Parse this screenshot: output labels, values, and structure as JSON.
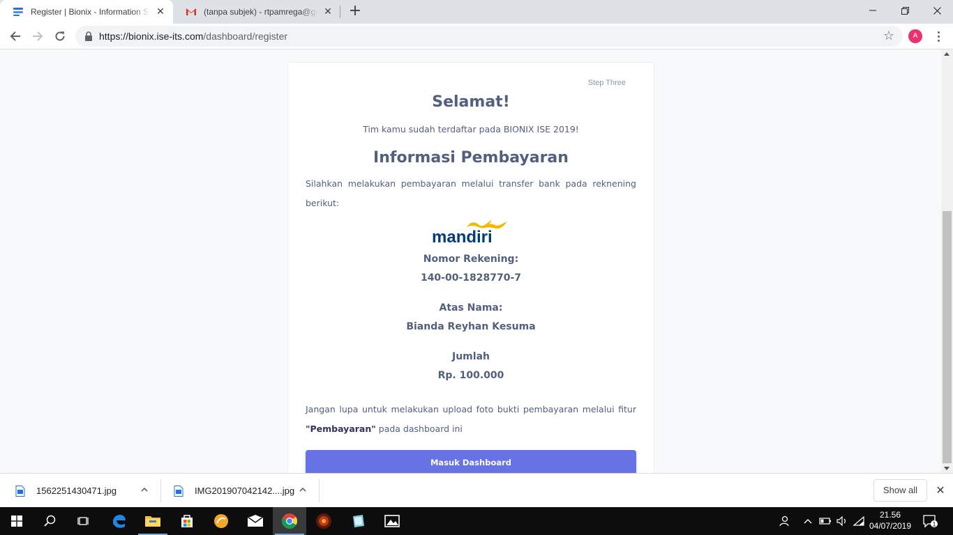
{
  "browser": {
    "tabs": [
      {
        "title": "Register | Bionix - Information Sy",
        "favicon": "bionix-favicon",
        "active": true
      },
      {
        "title": "(tanpa subjek) - rtpamrega@gma",
        "favicon": "gmail-icon",
        "active": false
      }
    ],
    "url": {
      "host": "https://bionix.ise-its.com",
      "path": "/dashboard/register"
    },
    "profile_initial": "A"
  },
  "page": {
    "step_label": "Step Three",
    "heading": "Selamat!",
    "subtitle": "Tim kamu sudah terdaftar pada BIONIX ISE 2019!",
    "payment_heading": "Informasi Pembayaran",
    "instruction": "Silahkan melakukan pembayaran melalui transfer bank pada reknening berikut:",
    "bank_logo_text": "mandiri",
    "account_number_label": "Nomor Rekening:",
    "account_number": "140-00-1828770-7",
    "account_name_label": "Atas Nama:",
    "account_name": "Bianda Reyhan Kesuma",
    "amount_label": "Jumlah",
    "amount": "Rp. 100.000",
    "reminder_text": "Jangan lupa untuk melakukan upload foto bukti pembayaran melalui fitur",
    "reminder_bold": "\"Pembayaran\"",
    "reminder_tail": " pada dashboard ini",
    "button_label": "Masuk Dashboard",
    "accent_color": "#6772e5"
  },
  "downloads": {
    "items": [
      {
        "filename": "1562251430471.jpg"
      },
      {
        "filename": "IMG201907042142....jpg"
      }
    ],
    "show_all_label": "Show all"
  },
  "taskbar": {
    "apps": [
      "windows-start",
      "search",
      "task-view",
      "edge",
      "file-explorer",
      "store",
      "app-orange",
      "mail",
      "chrome",
      "game-app",
      "notes-app",
      "photos"
    ],
    "time": "21.56",
    "date": "04/07/2019",
    "notification_count": "1"
  }
}
